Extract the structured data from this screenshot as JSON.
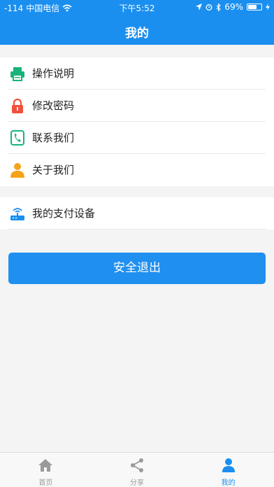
{
  "status_bar": {
    "signal": "-114",
    "carrier": "中国电信",
    "time": "下午5:52",
    "battery": "69%",
    "battery_level": 0.69
  },
  "header": {
    "title": "我的"
  },
  "menu_group_1": [
    {
      "label": "操作说明",
      "icon": "printer-icon",
      "color": "#19b37a"
    },
    {
      "label": "修改密码",
      "icon": "lock-icon",
      "color": "#f0503c"
    },
    {
      "label": "联系我们",
      "icon": "phone-icon",
      "color": "#19b37a"
    },
    {
      "label": "关于我们",
      "icon": "person-icon",
      "color": "#f5a21b"
    }
  ],
  "menu_group_2": [
    {
      "label": "我的支付设备",
      "icon": "router-icon",
      "color": "#1a8ff0"
    }
  ],
  "logout_button": {
    "label": "安全退出"
  },
  "tabbar": [
    {
      "label": "首页",
      "icon": "home-icon",
      "active": false
    },
    {
      "label": "分享",
      "icon": "share-icon",
      "active": false
    },
    {
      "label": "我的",
      "icon": "user-icon",
      "active": true
    }
  ],
  "colors": {
    "primary": "#1a8ff0",
    "inactive": "#9a9a9a"
  }
}
